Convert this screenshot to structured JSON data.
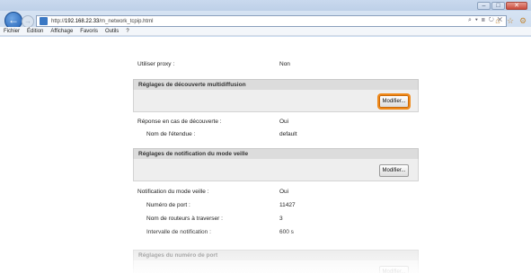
{
  "window": {
    "controls": {
      "minimize": "–",
      "maximize": "□",
      "close": "✕"
    }
  },
  "nav": {
    "url_prefix": "http://",
    "url_host": "192.168.22.33",
    "url_path": "/m_network_tcpip.html",
    "addr_tools": "⌕ ▾ ≣ ↻ ✕",
    "icons": {
      "home": "⌂",
      "favorites": "☆",
      "tools": "⚙"
    }
  },
  "menu": [
    "Fichier",
    "Édition",
    "Affichage",
    "Favoris",
    "Outils",
    "?"
  ],
  "content": {
    "proxy": {
      "label": "Utiliser proxy :",
      "value": "Non"
    },
    "discovery": {
      "title": "Réglages de découverte multidiffusion",
      "button": "Modifier...",
      "rows": [
        {
          "label": "Réponse en cas de découverte :",
          "value": "Oui"
        },
        {
          "label": "Nom de l'étendue :",
          "value": "default"
        }
      ]
    },
    "sleep": {
      "title": "Réglages de notification du mode veille",
      "button": "Modifier...",
      "rows": [
        {
          "label": "Notification du mode veille :",
          "value": "Oui"
        },
        {
          "label": "Numéro de port :",
          "value": "11427"
        },
        {
          "label": "Nom de routeurs à traverser :",
          "value": "3"
        },
        {
          "label": "Intervalle de notification :",
          "value": "600 s"
        }
      ]
    },
    "port": {
      "title": "Réglages du numéro de port",
      "button": "Modifier..."
    }
  }
}
